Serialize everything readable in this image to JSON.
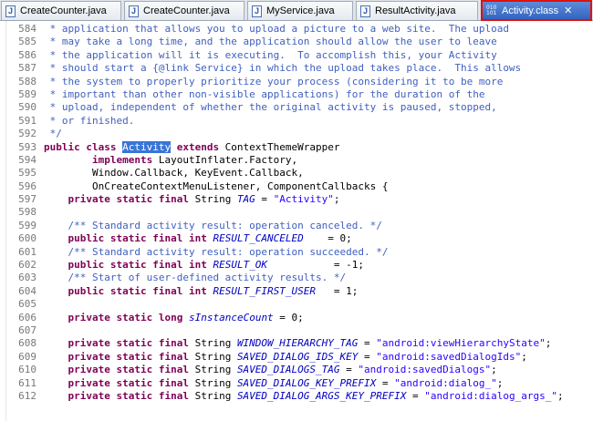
{
  "tabs": [
    {
      "label": "CreateCounter.java",
      "icon": "java-file-icon",
      "active": false
    },
    {
      "label": "CreateCounter.java",
      "icon": "java-file-icon",
      "active": false
    },
    {
      "label": "MyService.java",
      "icon": "java-file-icon",
      "active": false
    },
    {
      "label": "ResultActivity.java",
      "icon": "java-file-icon",
      "active": false
    },
    {
      "label": "Activity.class",
      "icon": "class-file-icon",
      "active": true
    }
  ],
  "icon_glyphs": {
    "java_file": "J",
    "class_file_top": "010",
    "class_file_bottom": "101",
    "close": "✕"
  },
  "colors": {
    "comment": "#3f5fbf",
    "keyword": "#7f0055",
    "string": "#2a00ff",
    "field": "#0000c0",
    "selection": "#3875d7",
    "active_tab_highlight": "#e01010"
  },
  "code": {
    "line_numbers": [
      "584",
      "585",
      "586",
      "587",
      "588",
      "589",
      "590",
      "591",
      "592",
      "593",
      "594",
      "595",
      "596",
      "597",
      "598",
      "599",
      "600",
      "601",
      "602",
      "603",
      "604",
      "605",
      "606",
      "607",
      "608",
      "609",
      "610",
      "611",
      "612"
    ],
    "lines": [
      [
        {
          "t": "cm",
          "v": " * application that allows you to upload a picture to a web site.  The upload"
        }
      ],
      [
        {
          "t": "cm",
          "v": " * may take a long time, and the application should allow the user to leave"
        }
      ],
      [
        {
          "t": "cm",
          "v": " * the application will it is executing.  To accomplish this, your Activity"
        }
      ],
      [
        {
          "t": "cm",
          "v": " * should start a {@link Service} in which the upload takes place.  This allows"
        }
      ],
      [
        {
          "t": "cm",
          "v": " * the system to properly prioritize your process (considering it to be more"
        }
      ],
      [
        {
          "t": "cm",
          "v": " * important than other non-visible applications) for the duration of the"
        }
      ],
      [
        {
          "t": "cm",
          "v": " * upload, independent of whether the original activity is paused, stopped,"
        }
      ],
      [
        {
          "t": "cm",
          "v": " * or finished."
        }
      ],
      [
        {
          "t": "cm",
          "v": " */"
        }
      ],
      [
        {
          "t": "kw",
          "v": "public class "
        },
        {
          "t": "sel",
          "v": "Activity"
        },
        {
          "t": "",
          "v": " "
        },
        {
          "t": "kw",
          "v": "extends"
        },
        {
          "t": "",
          "v": " ContextThemeWrapper"
        }
      ],
      [
        {
          "t": "",
          "v": "        "
        },
        {
          "t": "kw",
          "v": "implements"
        },
        {
          "t": "",
          "v": " LayoutInflater.Factory,"
        }
      ],
      [
        {
          "t": "",
          "v": "        Window.Callback, KeyEvent.Callback,"
        }
      ],
      [
        {
          "t": "",
          "v": "        OnCreateContextMenuListener, ComponentCallbacks {"
        }
      ],
      [
        {
          "t": "",
          "v": "    "
        },
        {
          "t": "kw",
          "v": "private static final"
        },
        {
          "t": "",
          "v": " String "
        },
        {
          "t": "fld",
          "v": "TAG"
        },
        {
          "t": "",
          "v": " = "
        },
        {
          "t": "st",
          "v": "\"Activity\""
        },
        {
          "t": "",
          "v": ";"
        }
      ],
      [
        {
          "t": "",
          "v": ""
        }
      ],
      [
        {
          "t": "",
          "v": "    "
        },
        {
          "t": "cm",
          "v": "/** Standard activity result: operation canceled. */"
        }
      ],
      [
        {
          "t": "",
          "v": "    "
        },
        {
          "t": "kw",
          "v": "public static final int"
        },
        {
          "t": "",
          "v": " "
        },
        {
          "t": "fld",
          "v": "RESULT_CANCELED"
        },
        {
          "t": "",
          "v": "    = 0;"
        }
      ],
      [
        {
          "t": "",
          "v": "    "
        },
        {
          "t": "cm",
          "v": "/** Standard activity result: operation succeeded. */"
        }
      ],
      [
        {
          "t": "",
          "v": "    "
        },
        {
          "t": "kw",
          "v": "public static final int"
        },
        {
          "t": "",
          "v": " "
        },
        {
          "t": "fld",
          "v": "RESULT_OK"
        },
        {
          "t": "",
          "v": "           = -1;"
        }
      ],
      [
        {
          "t": "",
          "v": "    "
        },
        {
          "t": "cm",
          "v": "/** Start of user-defined activity results. */"
        }
      ],
      [
        {
          "t": "",
          "v": "    "
        },
        {
          "t": "kw",
          "v": "public static final int"
        },
        {
          "t": "",
          "v": " "
        },
        {
          "t": "fld",
          "v": "RESULT_FIRST_USER"
        },
        {
          "t": "",
          "v": "   = 1;"
        }
      ],
      [
        {
          "t": "",
          "v": ""
        }
      ],
      [
        {
          "t": "",
          "v": "    "
        },
        {
          "t": "kw",
          "v": "private static long"
        },
        {
          "t": "",
          "v": " "
        },
        {
          "t": "fld",
          "v": "sInstanceCount"
        },
        {
          "t": "",
          "v": " = 0;"
        }
      ],
      [
        {
          "t": "",
          "v": ""
        }
      ],
      [
        {
          "t": "",
          "v": "    "
        },
        {
          "t": "kw",
          "v": "private static final"
        },
        {
          "t": "",
          "v": " String "
        },
        {
          "t": "fld",
          "v": "WINDOW_HIERARCHY_TAG"
        },
        {
          "t": "",
          "v": " = "
        },
        {
          "t": "st",
          "v": "\"android:viewHierarchyState\""
        },
        {
          "t": "",
          "v": ";"
        }
      ],
      [
        {
          "t": "",
          "v": "    "
        },
        {
          "t": "kw",
          "v": "private static final"
        },
        {
          "t": "",
          "v": " String "
        },
        {
          "t": "fld",
          "v": "SAVED_DIALOG_IDS_KEY"
        },
        {
          "t": "",
          "v": " = "
        },
        {
          "t": "st",
          "v": "\"android:savedDialogIds\""
        },
        {
          "t": "",
          "v": ";"
        }
      ],
      [
        {
          "t": "",
          "v": "    "
        },
        {
          "t": "kw",
          "v": "private static final"
        },
        {
          "t": "",
          "v": " String "
        },
        {
          "t": "fld",
          "v": "SAVED_DIALOGS_TAG"
        },
        {
          "t": "",
          "v": " = "
        },
        {
          "t": "st",
          "v": "\"android:savedDialogs\""
        },
        {
          "t": "",
          "v": ";"
        }
      ],
      [
        {
          "t": "",
          "v": "    "
        },
        {
          "t": "kw",
          "v": "private static final"
        },
        {
          "t": "",
          "v": " String "
        },
        {
          "t": "fld",
          "v": "SAVED_DIALOG_KEY_PREFIX"
        },
        {
          "t": "",
          "v": " = "
        },
        {
          "t": "st",
          "v": "\"android:dialog_\""
        },
        {
          "t": "",
          "v": ";"
        }
      ],
      [
        {
          "t": "",
          "v": "    "
        },
        {
          "t": "kw",
          "v": "private static final"
        },
        {
          "t": "",
          "v": " String "
        },
        {
          "t": "fld",
          "v": "SAVED_DIALOG_ARGS_KEY_PREFIX"
        },
        {
          "t": "",
          "v": " = "
        },
        {
          "t": "st",
          "v": "\"android:dialog_args_\""
        },
        {
          "t": "",
          "v": ";"
        }
      ]
    ]
  }
}
